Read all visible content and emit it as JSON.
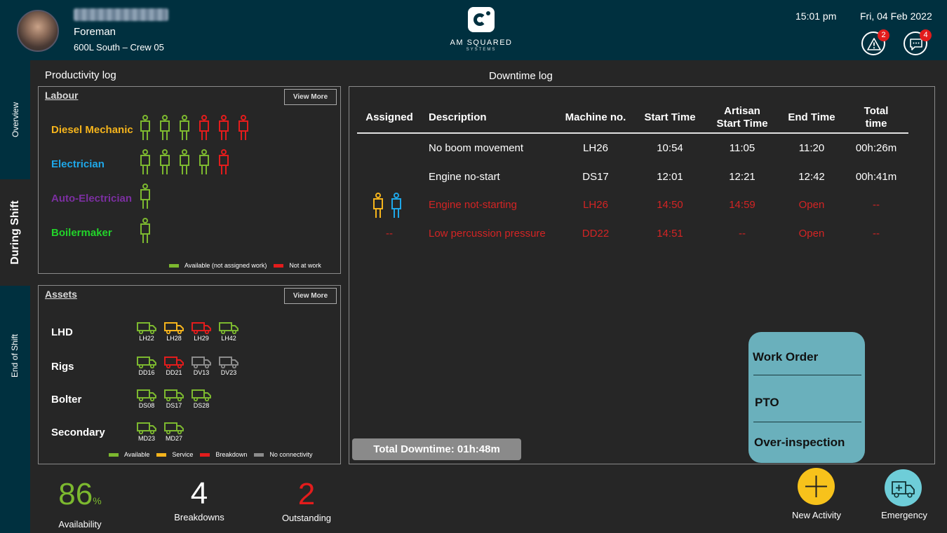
{
  "header": {
    "role": "Foreman",
    "crew": "600L South – Crew 05",
    "logo_text": "AM SQUARED",
    "logo_sub": "SYSTEMS",
    "time": "15:01 pm",
    "date": "Fri, 04 Feb 2022",
    "alerts_count": "2",
    "messages_count": "4"
  },
  "nav": {
    "overview": "Overview",
    "during_shift": "During Shift",
    "end_of_shift": "End of Shift"
  },
  "productivity": {
    "title": "Productivity log",
    "labour": {
      "title": "Labour",
      "view_more": "View More",
      "rows": [
        {
          "name": "Diesel Mechanic",
          "color": "#f5b41c",
          "available": 3,
          "not_at_work": 3
        },
        {
          "name": "Electrician",
          "color": "#1ea7e8",
          "available": 4,
          "not_at_work": 1
        },
        {
          "name": "Auto-Electrician",
          "color": "#7b2fa0",
          "available": 1,
          "not_at_work": 0
        },
        {
          "name": "Boilermaker",
          "color": "#22d42a",
          "available": 1,
          "not_at_work": 0
        }
      ],
      "legend_available": "Available (not assigned work)",
      "legend_not_at_work": "Not at work"
    },
    "assets": {
      "title": "Assets",
      "view_more": "View More",
      "rows": [
        {
          "name": "LHD",
          "items": [
            {
              "id": "LH22",
              "status": "available"
            },
            {
              "id": "LH28",
              "status": "service"
            },
            {
              "id": "LH29",
              "status": "breakdown"
            },
            {
              "id": "LH42",
              "status": "available"
            }
          ]
        },
        {
          "name": "Rigs",
          "items": [
            {
              "id": "DD16",
              "status": "available"
            },
            {
              "id": "DD21",
              "status": "breakdown"
            },
            {
              "id": "DV13",
              "status": "noconn"
            },
            {
              "id": "DV23",
              "status": "noconn"
            }
          ]
        },
        {
          "name": "Bolter",
          "items": [
            {
              "id": "DS08",
              "status": "available"
            },
            {
              "id": "DS17",
              "status": "available"
            },
            {
              "id": "DS28",
              "status": "available"
            }
          ]
        },
        {
          "name": "Secondary",
          "items": [
            {
              "id": "MD23",
              "status": "available"
            },
            {
              "id": "MD27",
              "status": "available"
            }
          ]
        }
      ],
      "legend": {
        "available": "Available",
        "service": "Service",
        "breakdown": "Breakdown",
        "noconn": "No connectivity"
      }
    },
    "kpis": {
      "availability_value": "86",
      "availability_unit": "%",
      "availability_label": "Availability",
      "breakdowns_value": "4",
      "breakdowns_label": "Breakdowns",
      "outstanding_value": "2",
      "outstanding_label": "Outstanding"
    }
  },
  "downtime": {
    "title": "Downtime log",
    "columns": {
      "assigned": "Assigned",
      "description": "Description",
      "machine": "Machine no.",
      "start": "Start Time",
      "artisan_1": "Artisan",
      "artisan_2": "Start Time",
      "end": "End Time",
      "total_1": "Total",
      "total_2": "time"
    },
    "rows": [
      {
        "assigned": "",
        "description": "No boom movement",
        "machine": "LH26",
        "start": "10:54",
        "artisan": "11:05",
        "end": "11:20",
        "total": "00h:26m",
        "open": false
      },
      {
        "assigned": "",
        "description": "Engine no-start",
        "machine": "DS17",
        "start": "12:01",
        "artisan": "12:21",
        "end": "12:42",
        "total": "00h:41m",
        "open": false
      },
      {
        "assigned": "icons",
        "description": "Engine not-starting",
        "machine": "LH26",
        "start": "14:50",
        "artisan": "14:59",
        "end": "Open",
        "total": "--",
        "open": true
      },
      {
        "assigned": "--",
        "description": "Low percussion pressure",
        "machine": "DD22",
        "start": "14:51",
        "artisan": "--",
        "end": "Open",
        "total": "--",
        "open": true
      }
    ],
    "total_label": "Total Downtime: 01h:48m"
  },
  "popup_menu": {
    "work_order": "Work Order",
    "pto": "PTO",
    "over_inspection": "Over-inspection"
  },
  "actions": {
    "new_activity": "New Activity",
    "emergency": "Emergency"
  },
  "colors": {
    "header_bg": "#00303f",
    "available": "#7cb82f",
    "service": "#f5b41c",
    "breakdown": "#e31c1c",
    "noconn": "#8c8c8c",
    "open_red": "#d42424",
    "kpi_green": "#7cb82f"
  }
}
